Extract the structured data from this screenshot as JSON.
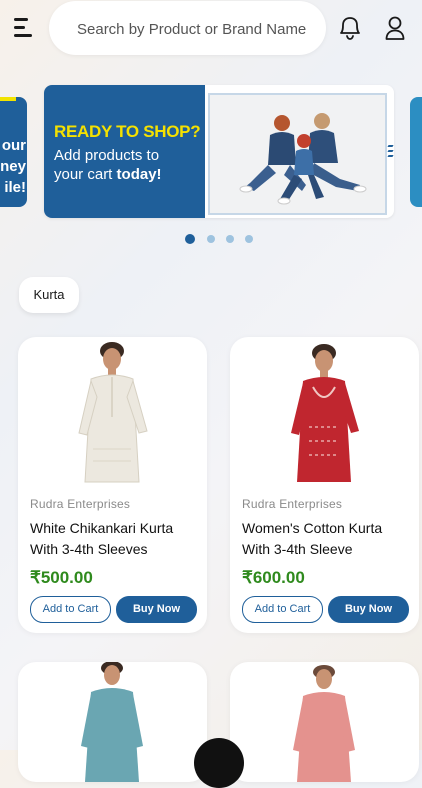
{
  "search": {
    "placeholder": "Search by Product or Brand Name"
  },
  "banner": {
    "headline": "READY TO SHOP?",
    "sub_line1": "Add products to",
    "sub_line2_normal": "your cart ",
    "sub_line2_bold": "today!",
    "peek_left_text": [
      "our",
      "ney",
      "ile!"
    ]
  },
  "carousel": {
    "slides": 4,
    "active_index": 0
  },
  "filter_chip": "Kurta",
  "products": [
    {
      "vendor": "Rudra Enterprises",
      "name": "White Chikankari Kurta With 3-4th Sleeves",
      "price": "₹500.00",
      "add_to_cart": "Add to Cart",
      "buy_now": "Buy Now",
      "color": "#ece8df"
    },
    {
      "vendor": "Rudra Enterprises",
      "name": "Women's Cotton Kurta With 3-4th Sleeve",
      "price": "₹600.00",
      "add_to_cart": "Add to Cart",
      "buy_now": "Buy Now",
      "color": "#c0262f"
    },
    {
      "color": "#6aa6b2"
    },
    {
      "color": "#e4928e"
    }
  ],
  "colors": {
    "accent": "#1f5f9a",
    "price_green": "#2f8a1d",
    "banner_yellow": "#f4e100"
  }
}
